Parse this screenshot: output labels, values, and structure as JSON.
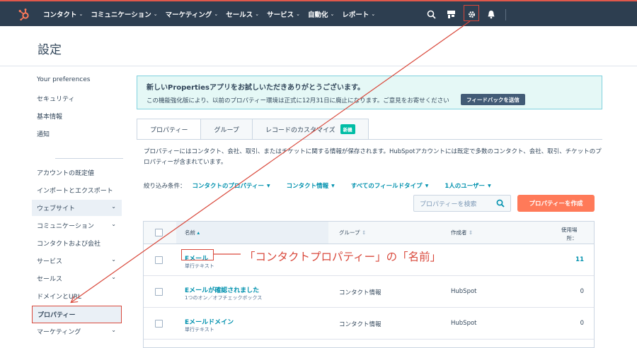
{
  "topnav": {
    "items": [
      "コンタクト",
      "コミュニケーション",
      "マーケティング",
      "セールス",
      "サービス",
      "自動化",
      "レポート"
    ],
    "accent": "#ff7a59"
  },
  "page": {
    "title": "設定"
  },
  "sidebar": {
    "items": [
      {
        "label": "Your preferences"
      },
      {
        "label": "セキュリティ"
      },
      {
        "label": "基本情報"
      },
      {
        "label": "通知"
      },
      {
        "label": "アカウントの既定値"
      },
      {
        "label": "インポートとエクスポート"
      },
      {
        "label": "ウェブサイト"
      },
      {
        "label": "コミュニケーション"
      },
      {
        "label": "コンタクトおよび会社"
      },
      {
        "label": "サービス"
      },
      {
        "label": "セールス"
      },
      {
        "label": "ドメインとURL"
      },
      {
        "label": "プロパティー"
      },
      {
        "label": "マーケティング"
      }
    ]
  },
  "banner": {
    "title": "新しいPropertiesアプリをお試しいただきありがとうございます。",
    "text": "この機能強化版により、以前のプロパティー環境は正式に12月31日に廃止になります。ご意見をお寄せください",
    "button": "フィードバックを送信"
  },
  "tabs": [
    {
      "label": "プロパティー"
    },
    {
      "label": "グループ"
    },
    {
      "label": "レコードのカスタマイズ",
      "badge": "新機"
    }
  ],
  "description": "プロパティーにはコンタクト、会社、取引、またはチケットに関する情報が保存されます。HubSpotアカウントには既定で多数のコンタクト、会社、取引、チケットのプロパティーが含まれています。",
  "filters": {
    "label": "絞り込み条件：",
    "items": [
      "コンタクトのプロパティー",
      "コンタクト情報",
      "すべてのフィールドタイプ",
      "1人のユーザー"
    ]
  },
  "search": {
    "placeholder": "プロパティーを検索"
  },
  "create_button": "プロパティーを作成",
  "table": {
    "headers": {
      "name": "名前",
      "group": "グループ",
      "creator": "作成者",
      "usage1": "使用場",
      "usage2": "所："
    },
    "rows": [
      {
        "name": "Eメール",
        "type": "単行テキスト",
        "group": "",
        "creator": "",
        "usage": "11"
      },
      {
        "name": "Eメールが確認されました",
        "type": "1つのオン／オフチェックボックス",
        "group": "コンタクト情報",
        "creator": "HubSpot",
        "usage": "0"
      },
      {
        "name": "Eメールドメイン",
        "type": "単行テキスト",
        "group": "コンタクト情報",
        "creator": "HubSpot",
        "usage": "0"
      }
    ]
  },
  "annotation": "「コンタクトプロパティー」の「名前」"
}
